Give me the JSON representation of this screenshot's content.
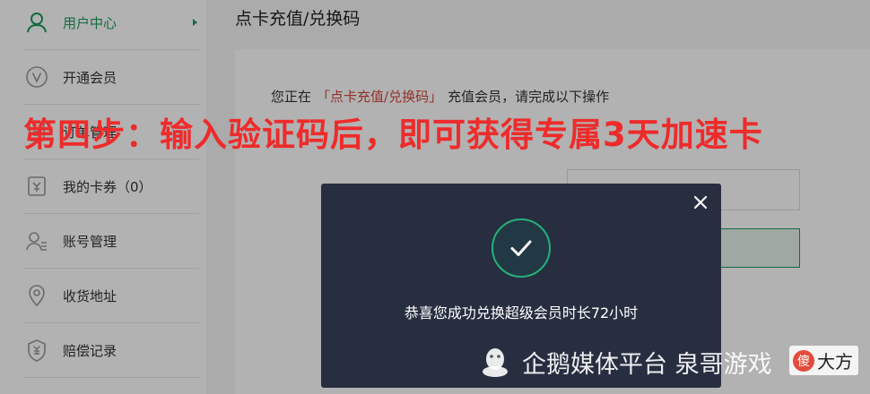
{
  "sidebar": {
    "items": [
      {
        "label": "用户中心",
        "icon": "user-icon",
        "active": true
      },
      {
        "label": "开通会员",
        "icon": "vip-icon"
      },
      {
        "label": "订单管理",
        "icon": "order-icon"
      },
      {
        "label": "我的卡券（0）",
        "icon": "coupon-icon"
      },
      {
        "label": "账号管理",
        "icon": "account-icon"
      },
      {
        "label": "收货地址",
        "icon": "location-icon"
      },
      {
        "label": "赔偿记录",
        "icon": "compensation-icon"
      }
    ]
  },
  "main": {
    "title": "点卡充值/兑换码",
    "desc_prefix": "您正在",
    "desc_highlight": "「点卡充值/兑换码」",
    "desc_suffix": "充值会员，请完成以下操作"
  },
  "caption": "第四步：输入验证码后，即可获得专属3天加速卡",
  "toast": {
    "message": "恭喜您成功兑换超级会员时长72小时"
  },
  "watermark": {
    "text": "企鹅媒体平台 泉哥游戏",
    "corner_mark": "傻",
    "corner_text": "大方"
  },
  "colors": {
    "accent": "#1a9b5b",
    "highlight": "#d2463b",
    "caption": "#ee2b2b",
    "toast_bg": "#272e40",
    "check": "#27b07a"
  }
}
